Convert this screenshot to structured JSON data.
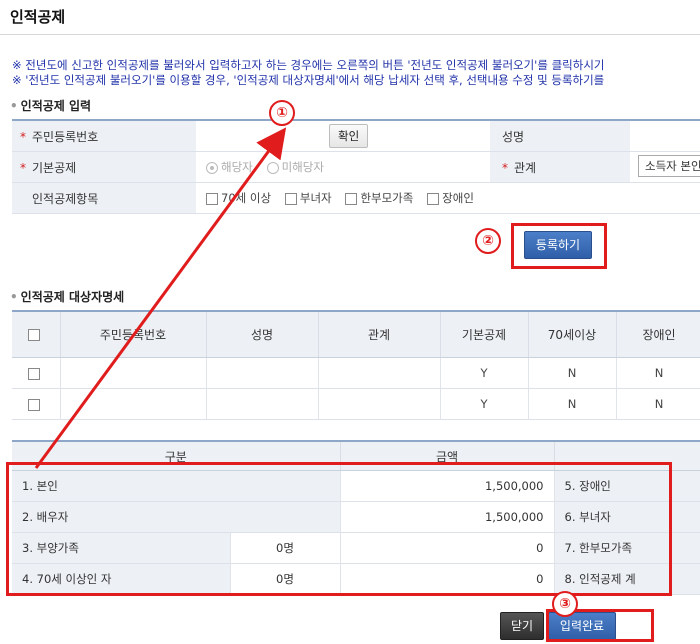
{
  "page": {
    "title": "인적공제"
  },
  "notice": {
    "line1": "※ 전년도에 신고한 인적공제를 불러와서 입력하고자 하는 경우에는 오른쪽의 버튼 '전년도 인적공제 불러오기'를 클릭하시기",
    "line2": "※ '전년도 인적공제 불러오기'를 이용할 경우, '인적공제 대상자명세'에서 해당 납세자 선택 후, 선택내용 수정 및 등록하기를"
  },
  "input_section": {
    "title": "인적공제 입력",
    "rrn_label": "주민등록번호",
    "confirm_label": "확인",
    "name_label": "성명",
    "basic_label": "기본공제",
    "applicable_label": "해당자",
    "not_applicable_label": "미해당자",
    "relation_label": "관계",
    "relation_value": "소득자 본인",
    "items_label": "인적공제항목",
    "options": [
      "70세 이상",
      "부녀자",
      "한부모가족",
      "장애인"
    ],
    "register_label": "등록하기"
  },
  "list_section": {
    "title": "인적공제 대상자명세",
    "headers": [
      "주민등록번호",
      "성명",
      "관계",
      "기본공제",
      "70세이상",
      "장애인"
    ],
    "rows": [
      {
        "basic": "Y",
        "over70": "N",
        "disabled": "N"
      },
      {
        "basic": "Y",
        "over70": "N",
        "disabled": "N"
      }
    ]
  },
  "summary": {
    "header_category": "구분",
    "header_amount": "금액",
    "rows": [
      {
        "label": "1. 본인",
        "count": "",
        "amount": "1,500,000",
        "right_label": "5. 장애인"
      },
      {
        "label": "2. 배우자",
        "count": "",
        "amount": "1,500,000",
        "right_label": "6. 부녀자"
      },
      {
        "label": "3. 부양가족",
        "count": "0명",
        "amount": "0",
        "right_label": "7. 한부모가족"
      },
      {
        "label": "4. 70세 이상인 자",
        "count": "0명",
        "amount": "0",
        "right_label": "8. 인적공제 계"
      }
    ]
  },
  "footer": {
    "close_label": "닫기",
    "complete_label": "입력완료"
  },
  "annotations": {
    "step1": "①",
    "step2": "②",
    "step3": "③"
  },
  "colors": {
    "accent_red": "#e01c1c",
    "primary_blue": "#2f5fa8",
    "notice_blue": "#2233aa"
  }
}
